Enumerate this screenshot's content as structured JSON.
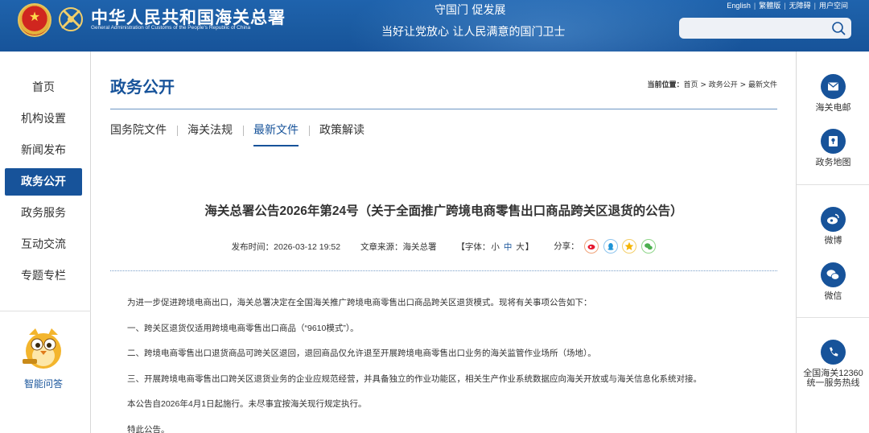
{
  "header": {
    "site_title": "中华人民共和国海关总署",
    "site_subtitle": "General Administration of Customs of the People's Republic of China",
    "slogan_top": "守国门  促发展",
    "slogan_bottom": "当好让党放心  让人民满意的国门卫士",
    "links": [
      "English",
      "繁體版",
      "无障碍",
      "用户空间"
    ],
    "search_placeholder": ""
  },
  "left_nav": {
    "items": [
      {
        "label": "首页"
      },
      {
        "label": "机构设置"
      },
      {
        "label": "新闻发布"
      },
      {
        "label": "政务公开",
        "active": true
      },
      {
        "label": "政务服务"
      },
      {
        "label": "互动交流"
      },
      {
        "label": "专题专栏"
      }
    ],
    "ai_label": "智能问答"
  },
  "main": {
    "page_title": "政务公开",
    "breadcrumb_label": "当前位置：",
    "breadcrumb_path": "首页 > 政务公开 > 最新文件",
    "tabs": [
      {
        "label": "国务院文件"
      },
      {
        "label": "海关法规"
      },
      {
        "label": "最新文件",
        "active": true
      },
      {
        "label": "政策解读"
      }
    ]
  },
  "article": {
    "title": "海关总署公告2026年第24号（关于全面推广跨境电商零售出口商品跨关区退货的公告）",
    "publish_time": "发布时间：2026-03-12 19:52",
    "source": "文章来源：海关总署",
    "font_label_open": "【字体：",
    "font_small": "小",
    "font_mid": "中",
    "font_large": "大",
    "font_label_close": "】",
    "share_label": "分享：",
    "paragraphs": [
      "为进一步促进跨境电商出口，海关总署决定在全国海关推广跨境电商零售出口商品跨关区退货模式。现将有关事项公告如下：",
      "一、跨关区退货仅适用跨境电商零售出口商品（“9610模式”）。",
      "二、跨境电商零售出口退货商品可跨关区退回，退回商品仅允许退至开展跨境电商零售出口业务的海关监管作业场所（场地）。",
      "三、开展跨境电商零售出口跨关区退货业务的企业应规范经营，并具备独立的作业功能区，相关生产作业系统数据应向海关开放或与海关信息化系统对接。",
      "本公告自2026年4月1日起施行。未尽事宜按海关现行规定执行。",
      "特此公告。"
    ]
  },
  "right_bar": {
    "items": [
      {
        "label": "海关电邮",
        "icon": "mail-icon"
      },
      {
        "label": "政务地图",
        "icon": "map-icon"
      },
      {
        "label": "微博",
        "icon": "weibo-icon"
      },
      {
        "label": "微信",
        "icon": "wechat-icon"
      },
      {
        "label_line1": "全国海关12360",
        "label_line2": "统一服务热线",
        "icon": "phone-icon"
      }
    ]
  },
  "colors": {
    "brand_blue": "#17539a",
    "header_blue": "#1f63ad"
  }
}
